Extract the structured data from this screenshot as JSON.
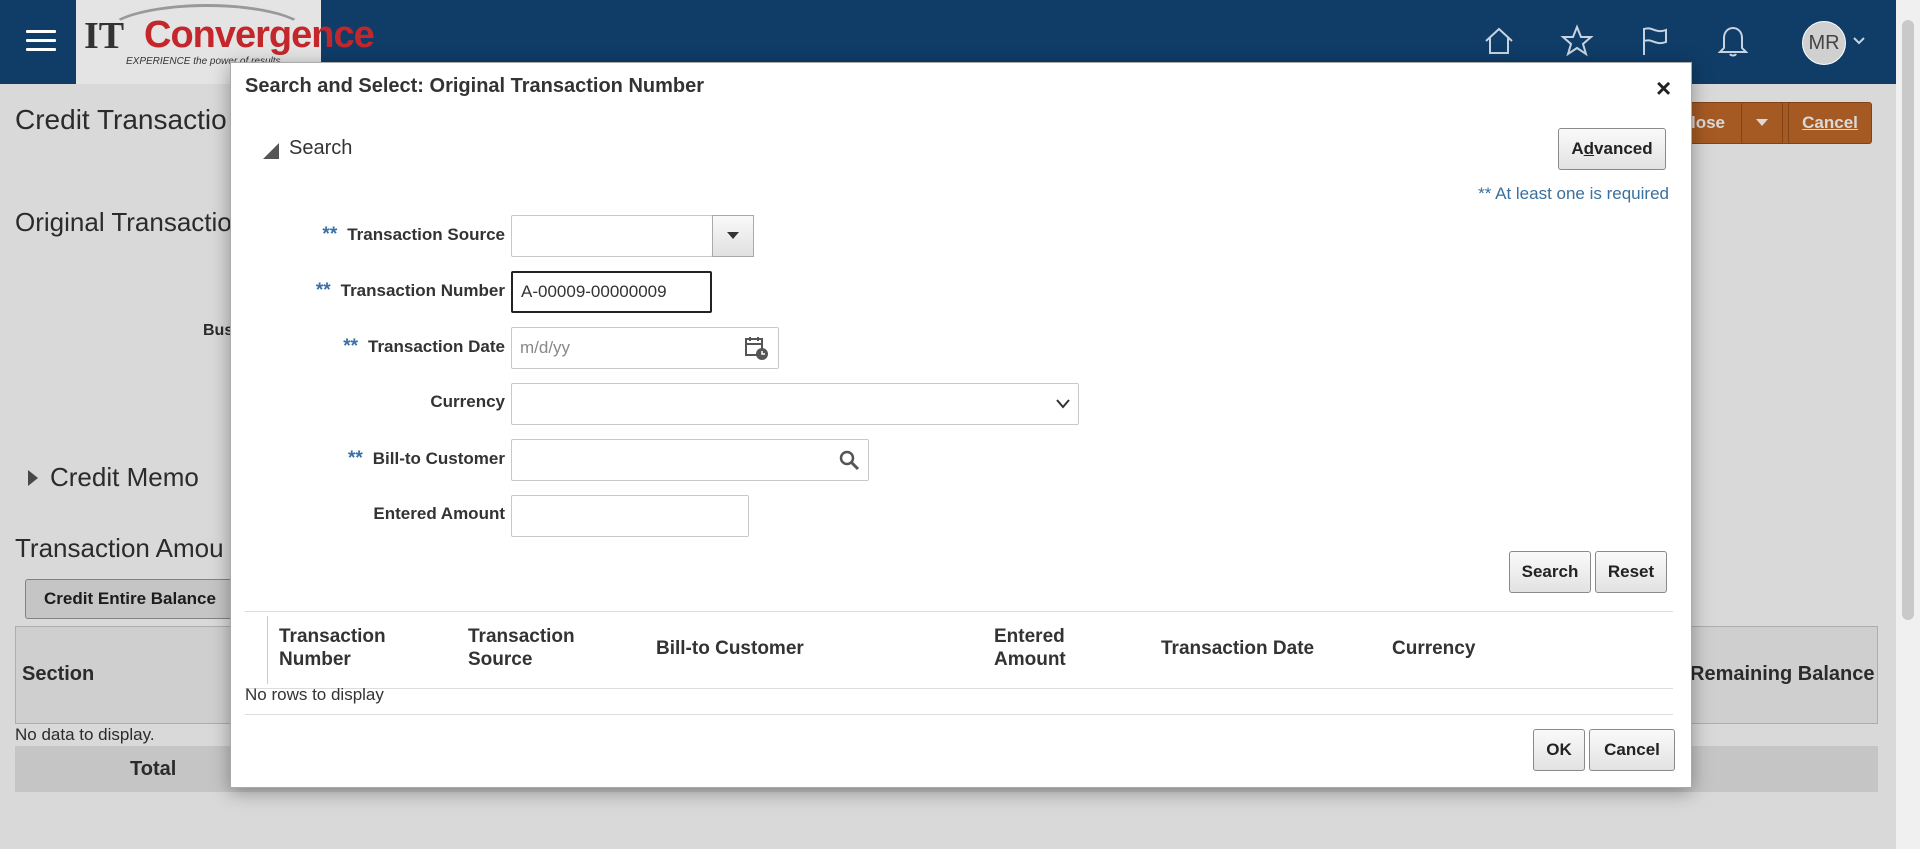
{
  "topbar": {
    "logo_it": "IT",
    "logo_conv": "Convergence",
    "logo_tag": "EXPERIENCE the power of results",
    "avatar_initials": "MR",
    "icons": [
      "home-icon",
      "star-icon",
      "flag-icon",
      "bell-icon"
    ]
  },
  "background": {
    "page_title": "Credit Transactio",
    "section_title": "Original Transactio",
    "bus_label": "Bus",
    "credit_memo": "Credit Memo",
    "transaction_amount": "Transaction Amou",
    "credit_entire_balance": "Credit Entire Balance",
    "section_col": "Section",
    "remaining_balance_col": "Remaining Balance",
    "no_data": "No data to display.",
    "total": "Total",
    "close_btn": "lose",
    "cancel_btn": "Cancel",
    "accent": "#c26a2a"
  },
  "dialog": {
    "title": "Search and Select: Original Transaction Number",
    "close": "×",
    "search_header": "Search",
    "advanced_btn": "Advanced",
    "required_note": "** At least one is required",
    "fields": {
      "transaction_source": {
        "label": "Transaction Source",
        "value": ""
      },
      "transaction_number": {
        "label": "Transaction Number",
        "value": "A-00009-00000009"
      },
      "transaction_date": {
        "label": "Transaction Date",
        "placeholder": "m/d/yy"
      },
      "currency": {
        "label": "Currency",
        "value": ""
      },
      "bill_to_customer": {
        "label": "Bill-to Customer",
        "value": ""
      },
      "entered_amount": {
        "label": "Entered Amount",
        "value": ""
      }
    },
    "search_btn": "Search",
    "reset_btn": "Reset",
    "columns": {
      "transaction_number": [
        "Transaction",
        "Number"
      ],
      "transaction_source": [
        "Transaction",
        "Source"
      ],
      "bill_to_customer": "Bill-to Customer",
      "entered_amount": [
        "Entered",
        "Amount"
      ],
      "transaction_date": "Transaction Date",
      "currency": "Currency"
    },
    "no_rows": "No rows to display",
    "ok_btn": "OK",
    "cancel_btn": "Cancel",
    "required_marker": "**"
  }
}
